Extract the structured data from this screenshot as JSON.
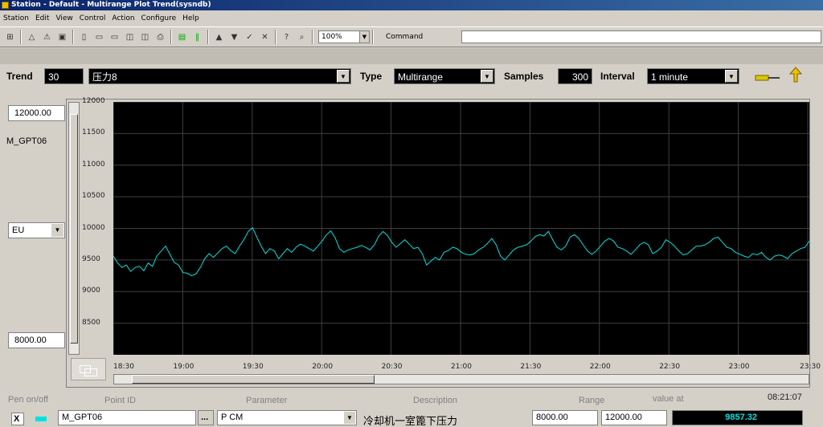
{
  "window": {
    "title": "Station - Default - Multirange Plot Trend(sysndb)"
  },
  "menu": [
    "Station",
    "Edit",
    "View",
    "Control",
    "Action",
    "Configure",
    "Help"
  ],
  "toolbar": {
    "zoom": "100%",
    "command_label": "Command",
    "command_value": ""
  },
  "trend": {
    "trend_label": "Trend",
    "trend_number": "30",
    "trend_name": "压力8",
    "type_label": "Type",
    "type_value": "Multirange",
    "samples_label": "Samples",
    "samples_value": "300",
    "interval_label": "Interval",
    "interval_value": "1 minute"
  },
  "left": {
    "range_high": "12000.00",
    "pen_name": "M_GPT06",
    "units": "EU",
    "range_low": "8000.00"
  },
  "chart_data": {
    "type": "line",
    "title": "",
    "xlabel": "",
    "ylabel": "",
    "y_ticks": [
      "12000",
      "11500",
      "11000",
      "10500",
      "10000",
      "9500",
      "9000",
      "8500"
    ],
    "x_ticks": [
      "18:30",
      "19:00",
      "19:30",
      "20:00",
      "20:30",
      "21:00",
      "21:30",
      "22:00",
      "22:30",
      "23:00",
      "23:30"
    ],
    "ylim": [
      8000,
      12000
    ],
    "grid": true,
    "line_color": "#00e0e0",
    "series": [
      {
        "name": "M_GPT06",
        "values": [
          9560,
          9450,
          9380,
          9420,
          9320,
          9380,
          9400,
          9330,
          9450,
          9400,
          9560,
          9640,
          9720,
          9590,
          9460,
          9420,
          9300,
          9290,
          9250,
          9280,
          9380,
          9520,
          9600,
          9540,
          9610,
          9680,
          9720,
          9650,
          9600,
          9720,
          9820,
          9950,
          10010,
          9860,
          9720,
          9600,
          9680,
          9640,
          9520,
          9600,
          9680,
          9620,
          9700,
          9750,
          9720,
          9680,
          9640,
          9720,
          9800,
          9900,
          9960,
          9850,
          9680,
          9620,
          9660,
          9680,
          9700,
          9730,
          9700,
          9660,
          9740,
          9880,
          9950,
          9890,
          9780,
          9700,
          9760,
          9820,
          9750,
          9680,
          9700,
          9600,
          9420,
          9480,
          9540,
          9500,
          9620,
          9650,
          9700,
          9680,
          9620,
          9590,
          9580,
          9600,
          9660,
          9700,
          9760,
          9840,
          9740,
          9560,
          9500,
          9580,
          9660,
          9700,
          9720,
          9740,
          9800,
          9870,
          9900,
          9880,
          9950,
          9820,
          9700,
          9660,
          9720,
          9860,
          9900,
          9840,
          9740,
          9640,
          9590,
          9640,
          9720,
          9800,
          9840,
          9800,
          9700,
          9680,
          9640,
          9590,
          9660,
          9740,
          9780,
          9740,
          9600,
          9640,
          9700,
          9820,
          9780,
          9720,
          9640,
          9580,
          9600,
          9660,
          9720,
          9720,
          9740,
          9780,
          9840,
          9860,
          9780,
          9700,
          9680,
          9620,
          9590,
          9560,
          9540,
          9600,
          9580,
          9620,
          9540,
          9500,
          9560,
          9580,
          9560,
          9520,
          9600,
          9640,
          9680,
          9700,
          9800
        ]
      }
    ]
  },
  "pens": {
    "headers": {
      "pen": "Pen on/off",
      "point": "Point ID",
      "param": "Parameter",
      "desc": "Description",
      "range": "Range",
      "value": "value at"
    },
    "time": "08:21:07",
    "row": {
      "checked": "X",
      "point_id": "M_GPT06",
      "browse": "...",
      "parameter": "P CM",
      "description": "冷却机一室篦下压力",
      "range_low": "8000.00",
      "range_high": "12000.00",
      "value": "9857.32"
    }
  }
}
